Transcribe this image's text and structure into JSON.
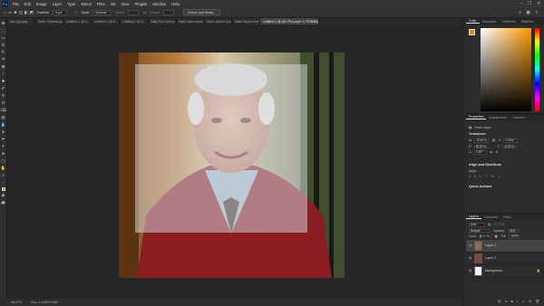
{
  "menubar": {
    "items": [
      "File",
      "Edit",
      "Image",
      "Layer",
      "Type",
      "Select",
      "Filter",
      "3D",
      "View",
      "Plugins",
      "Window",
      "Help"
    ],
    "right_icons": [
      "minimize-icon",
      "restore-icon",
      "close-icon"
    ]
  },
  "options": {
    "feather_label": "Feather:",
    "feather_value": "0 px",
    "style_label": "Style:",
    "style_value": "Normal",
    "width_label": "Width:",
    "height_label": "Height:",
    "select_mask_label": "Select and Mask..."
  },
  "tabs": [
    {
      "label": "sho (a).jpeg",
      "active": false
    },
    {
      "label": "Sean Sharma.jpeg",
      "active": false
    },
    {
      "label": "Untitled-1 @ 6...",
      "active": false
    },
    {
      "label": "Untitled-3 @ 6...",
      "active": false
    },
    {
      "label": "Untitled-2 @ 6...",
      "active": false
    },
    {
      "label": "Sally Rich print.jpeg",
      "active": false
    },
    {
      "label": "Sean Hare small Lin base.png",
      "active": false
    },
    {
      "label": "Sean Moore Cowell Cary.jpeg",
      "active": false
    },
    {
      "label": "Sean Moore Dyerfact 1.jpeg",
      "active": false
    },
    {
      "label": "Untitled-1 @ 66.7% (Layer 2, RGB/8#) *",
      "active": true
    }
  ],
  "status": {
    "zoom": "66.67%",
    "doc": "Doc: 3.15M/9.98M"
  },
  "color_panel": {
    "tabs": [
      "Color",
      "Swatches",
      "Gradients",
      "Patterns"
    ],
    "fg_color": "#d98f20"
  },
  "properties_panel": {
    "tabs": [
      "Properties",
      "Adjustments",
      "Libraries"
    ],
    "layer_type": "Pixel Layer",
    "transform_label": "Transform",
    "w_label": "W",
    "w_value": "10.67 in",
    "h_label": "H",
    "h_value": "10.67 in",
    "x_label": "X",
    "x_value": "1.23 in",
    "y_label": "Y",
    "y_value": "-0.01 in",
    "angle_value": "0.00°",
    "align_label": "Align and Distribute",
    "align_sub": "Align:",
    "quick_label": "Quick Actions"
  },
  "layers_panel": {
    "tabs": [
      "Layers",
      "Channels",
      "Paths"
    ],
    "kind_label": "Kind",
    "blend_mode": "Normal",
    "opacity_label": "Opacity:",
    "opacity_value": "51%",
    "lock_label": "Lock:",
    "fill_label": "Fill:",
    "fill_value": "100%",
    "layers": [
      {
        "name": "Layer 2",
        "selected": true
      },
      {
        "name": "Layer 1",
        "selected": false
      },
      {
        "name": "Background",
        "selected": false
      }
    ]
  }
}
